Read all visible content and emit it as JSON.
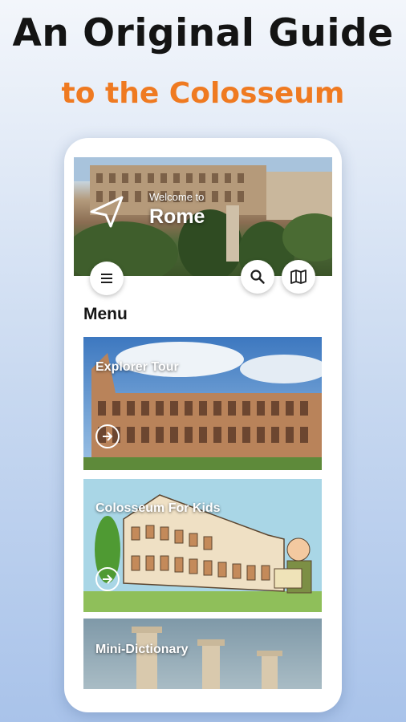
{
  "headline": "An Original Guide",
  "subheadline": "to the Colosseum",
  "colors": {
    "accent": "#ef7a21",
    "headline": "#141414"
  },
  "header": {
    "greeting": "Welcome to",
    "city": "Rome",
    "icons": {
      "location": "location-arrow-icon",
      "menu": "hamburger-menu-icon",
      "search": "search-icon",
      "map": "map-icon"
    }
  },
  "menu": {
    "title": "Menu",
    "items": [
      {
        "label": "Explorer Tour",
        "icon": "arrow-right-icon"
      },
      {
        "label": "Colosseum For Kids",
        "icon": "arrow-right-icon"
      },
      {
        "label": "Mini-Dictionary"
      }
    ]
  }
}
